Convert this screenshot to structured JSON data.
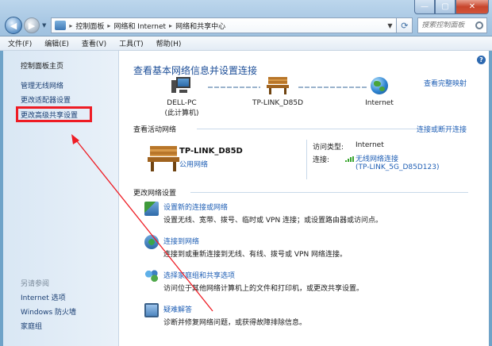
{
  "address_bar": {
    "segments": [
      "控制面板",
      "网络和 Internet",
      "网络和共享中心"
    ]
  },
  "search": {
    "placeholder": "搜索控制面板"
  },
  "menu": {
    "items": [
      "文件(F)",
      "编辑(E)",
      "查看(V)",
      "工具(T)",
      "帮助(H)"
    ]
  },
  "left_pane": {
    "home": "控制面板主页",
    "links": [
      "管理无线网络",
      "更改适配器设置",
      "更改高级共享设置"
    ],
    "see_also_title": "另请参阅",
    "see_also": [
      "Internet 选项",
      "Windows 防火墙",
      "家庭组"
    ]
  },
  "main": {
    "title": "查看基本网络信息并设置连接",
    "full_map_link": "查看完整映射",
    "nodes": [
      {
        "name": "DELL-PC",
        "sub": "(此计算机)"
      },
      {
        "name": "TP-LINK_D85D",
        "sub": ""
      },
      {
        "name": "Internet",
        "sub": ""
      }
    ],
    "active_section": {
      "title": "查看活动网络",
      "link": "连接或断开连接",
      "network_name": "TP-LINK_D85D",
      "network_type": "公用网络",
      "access_label": "访问类型:",
      "access_value": "Internet",
      "conn_label": "连接:",
      "conn_link_1": "无线网络连接",
      "conn_link_2": "(TP-LINK_5G_D85D123)"
    },
    "change_section": {
      "title": "更改网络设置",
      "tasks": [
        {
          "title": "设置新的连接或网络",
          "desc": "设置无线、宽带、拨号、临时或 VPN 连接；或设置路由器或访问点。"
        },
        {
          "title": "连接到网络",
          "desc": "连接到或重新连接到无线、有线、拨号或 VPN 网络连接。"
        },
        {
          "title": "选择家庭组和共享选项",
          "desc": "访问位于其他网络计算机上的文件和打印机，或更改共享设置。"
        },
        {
          "title": "疑难解答",
          "desc": "诊断并修复网络问题，或获得故障排除信息。"
        }
      ]
    }
  },
  "colors": {
    "link": "#1f5fb5",
    "title": "#1c4e98",
    "annotation": "#ee1c24"
  }
}
